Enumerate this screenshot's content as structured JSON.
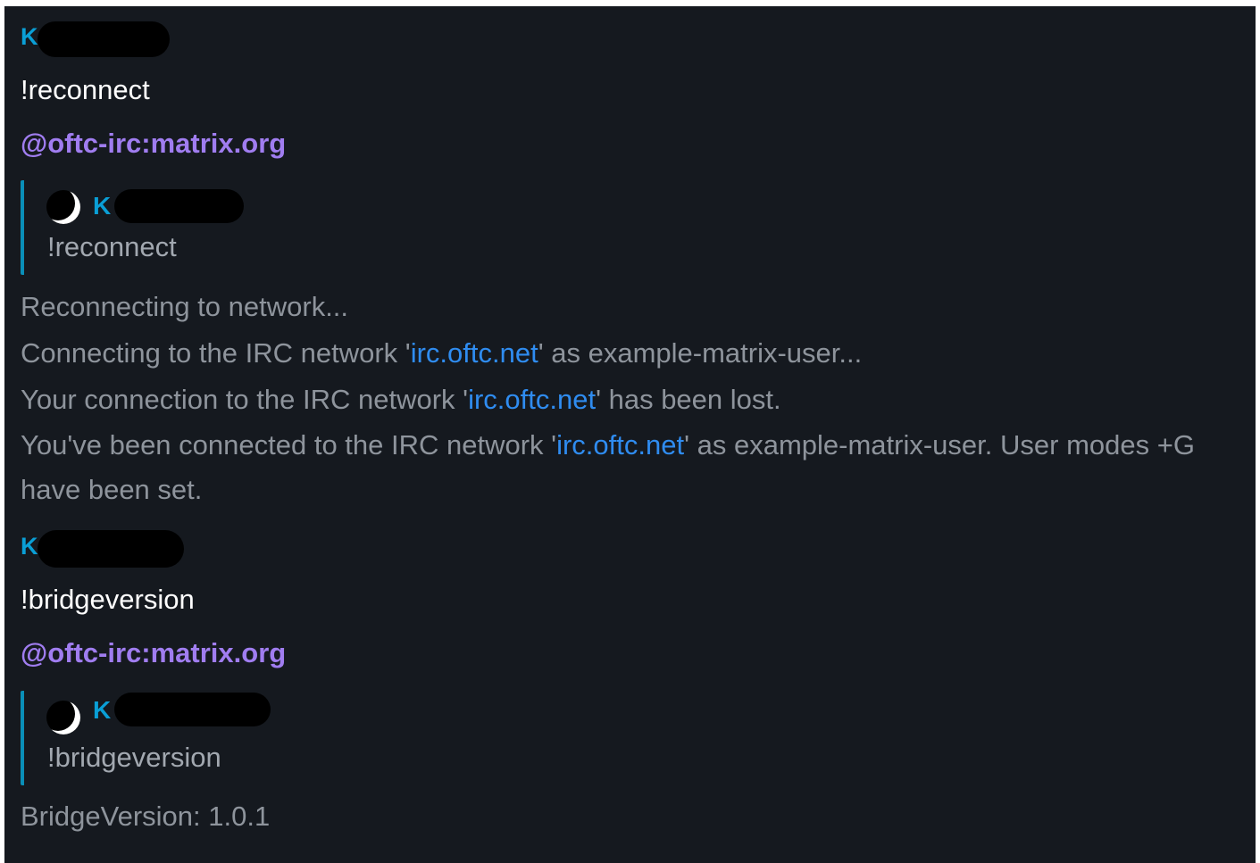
{
  "messages": {
    "first_user": {
      "sender_initial": "K"
    },
    "first_command": "!reconnect",
    "bot_name_1": "@oftc-irc:matrix.org",
    "quote_1": {
      "sender_initial": "K",
      "body": "!reconnect"
    },
    "notices_1": {
      "line1": "Reconnecting to network...",
      "line2_a": "Connecting to the IRC network '",
      "line2_link": "irc.oftc.net",
      "line2_b": "' as example-matrix-user...",
      "line3_a": "Your connection to the IRC network '",
      "line3_link": "irc.oftc.net",
      "line3_b": "' has been lost.",
      "line4_a": "You've been connected to the IRC network '",
      "line4_link": "irc.oftc.net",
      "line4_b": "' as example-matrix-user. User modes +G have been set."
    },
    "second_user": {
      "sender_initial": "K"
    },
    "second_command": "!bridgeversion",
    "bot_name_2": "@oftc-irc:matrix.org",
    "quote_2": {
      "sender_initial": "K",
      "body": "!bridgeversion"
    },
    "notices_2": {
      "line1": "BridgeVersion: 1.0.1"
    }
  },
  "colors": {
    "background": "#15191f",
    "sender": "#0a9fd6",
    "bot": "#a07df0",
    "notice": "#8e949c",
    "link": "#2f8cf0",
    "quote_bar": "#0a8fb8"
  },
  "icons": {
    "quote_avatar": "user-avatar-icon"
  }
}
